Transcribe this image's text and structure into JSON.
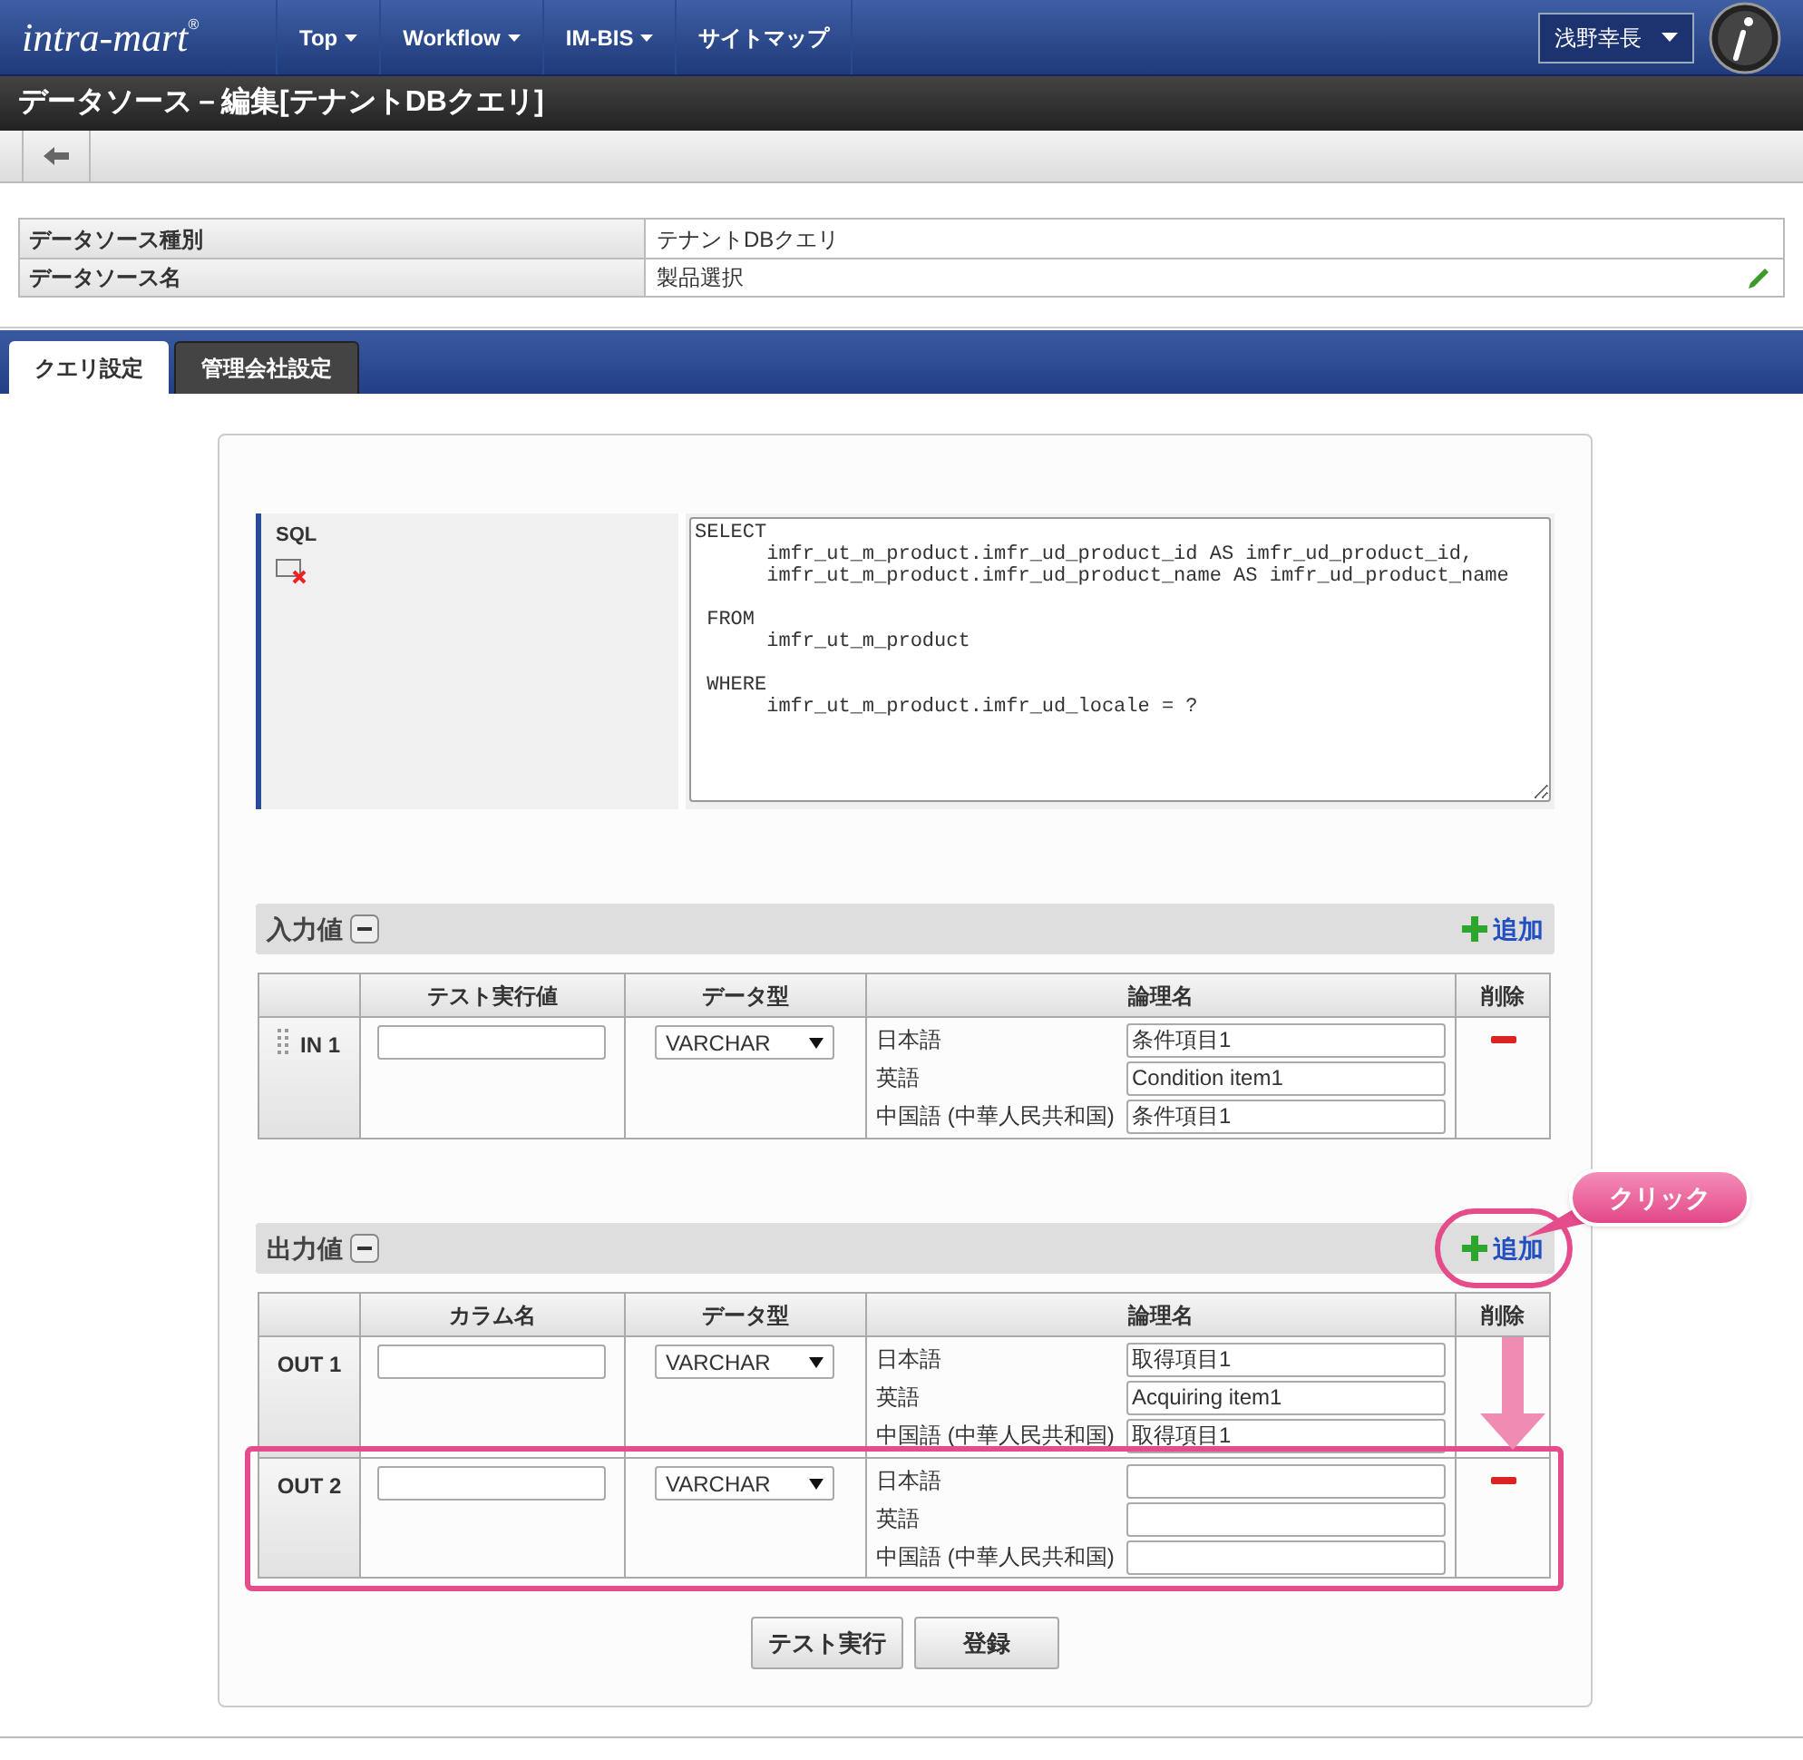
{
  "header": {
    "logo": "intra-mart",
    "logo_mark": "®",
    "nav": [
      {
        "label": "Top",
        "dropdown": true
      },
      {
        "label": "Workflow",
        "dropdown": true
      },
      {
        "label": "IM-BIS",
        "dropdown": true
      },
      {
        "label": "サイトマップ",
        "dropdown": false
      }
    ],
    "user": "浅野幸長"
  },
  "page_title": "データソース－編集[テナントDBクエリ]",
  "info": [
    {
      "label": "データソース種別",
      "value": "テナントDBクエリ"
    },
    {
      "label": "データソース名",
      "value": "製品選択"
    }
  ],
  "tabs": [
    {
      "label": "クエリ設定",
      "selected": true
    },
    {
      "label": "管理会社設定",
      "selected": false
    }
  ],
  "sql": {
    "label": "SQL",
    "text": "SELECT\n      imfr_ut_m_product.imfr_ud_product_id AS imfr_ud_product_id,\n      imfr_ut_m_product.imfr_ud_product_name AS imfr_ud_product_name\n\n FROM\n      imfr_ut_m_product\n\n WHERE\n      imfr_ut_m_product.imfr_ud_locale = ?"
  },
  "input_section": {
    "title": "入力値",
    "add": "追加",
    "columns": [
      "テスト実行値",
      "データ型",
      "論理名",
      "削除"
    ],
    "rows": [
      {
        "name": "IN 1",
        "draggable": true,
        "deletable": true,
        "type": "VARCHAR",
        "names": [
          {
            "lang": "日本語",
            "value": "条件項目1"
          },
          {
            "lang": "英語",
            "value": "Condition item1"
          },
          {
            "lang": "中国語 (中華人民共和国)",
            "value": "条件項目1"
          }
        ]
      }
    ]
  },
  "output_section": {
    "title": "出力値",
    "add": "追加",
    "columns": [
      "カラム名",
      "データ型",
      "論理名",
      "削除"
    ],
    "rows": [
      {
        "name": "OUT 1",
        "draggable": false,
        "deletable": false,
        "highlighted": false,
        "type": "VARCHAR",
        "names": [
          {
            "lang": "日本語",
            "value": "取得項目1"
          },
          {
            "lang": "英語",
            "value": "Acquiring item1"
          },
          {
            "lang": "中国語 (中華人民共和国)",
            "value": "取得項目1"
          }
        ]
      },
      {
        "name": "OUT 2",
        "draggable": false,
        "deletable": true,
        "highlighted": true,
        "type": "VARCHAR",
        "names": [
          {
            "lang": "日本語"
          },
          {
            "lang": "英語"
          },
          {
            "lang": "中国語 (中華人民共和国)"
          }
        ]
      }
    ]
  },
  "buttons": [
    "テスト実行",
    "登録"
  ],
  "callout": "クリック"
}
